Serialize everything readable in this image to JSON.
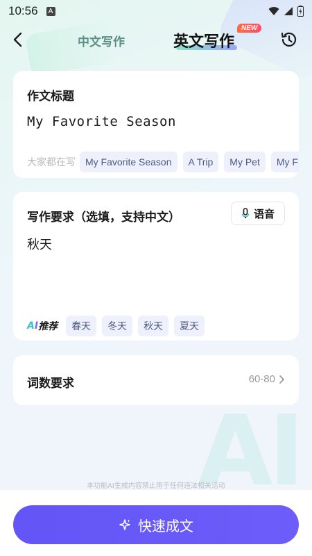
{
  "status_bar": {
    "time": "10:56",
    "notification_letter": "A"
  },
  "header": {
    "tab_chinese": "中文写作",
    "tab_english": "英文写作",
    "new_badge": "NEW"
  },
  "topic_card": {
    "title": "作文标题",
    "value": "My Favorite Season",
    "suggest_label": "大家都在写",
    "suggestions": [
      "My Favorite Season",
      "A Trip",
      "My Pet",
      "My F"
    ]
  },
  "requirement_card": {
    "title": "写作要求（选填，支持中文）",
    "voice_label": "语音",
    "value": "秋天",
    "ai_label_a": "A",
    "ai_label_i": "I",
    "ai_label_text": "推荐",
    "ai_tags": [
      "春天",
      "冬天",
      "秋天",
      "夏天"
    ]
  },
  "word_card": {
    "title": "词数要求",
    "value": "60-80"
  },
  "disclaimer": "本功能AI生成内容禁止用于任何违法相关活动",
  "submit": {
    "label": "快速成文"
  },
  "colors": {
    "accent": "#6355f6",
    "chip_bg": "#eef1fb",
    "chip_text": "#4e5a86"
  }
}
